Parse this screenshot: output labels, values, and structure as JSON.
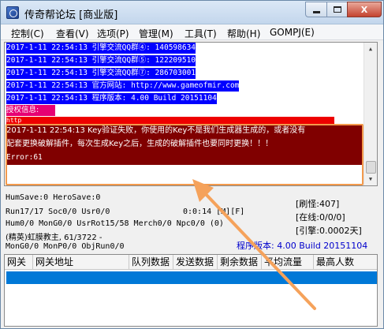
{
  "window": {
    "title": "传奇帮论坛 [商业版]",
    "close_label": "X"
  },
  "menu": {
    "items": [
      "控制(C)",
      "查看(V)",
      "选项(P)",
      "管理(M)",
      "工具(T)",
      "帮助(H)",
      "GOMPJ(E)"
    ]
  },
  "log": {
    "lines": [
      "2017-1-11 22:54:13 引擎交流QQ群④: 140598634",
      "2017-1-11 22:54:13 引擎交流QQ群⑤: 122209510",
      "2017-1-11 22:54:13 引擎交流QQ群⑦: 286703001",
      "2017-1-11 22:54:13 官方网站: http://www.gameofmir.com",
      "2017-1-11 22:54:13 程序版本: 4.00 Build 20151104"
    ],
    "auth_label": "授权信息:",
    "auth_url": "http",
    "error_line1": "2017-1-11 22:54:13 Key验证失败，你使用的Key不是我们生成器生成的，或者没有",
    "error_line2": "配套更换破解插件，每次生成Key之后，生成的破解插件也要同时更换！！！",
    "error_line3": "Error:61"
  },
  "status": {
    "hum_save": "HumSave:0 HeroSave:0",
    "run": "Run17/17 Soc0/0 Usr0/0",
    "time": "0:0:14 [M][F]",
    "hum": "Hum0/0 MonG0/0 UsrRot15/58 Merch0/0 Npc0/0 (0)",
    "elite": "(精英)虹膜教主, 61/3722 -",
    "mon": "MonG0/0 MonP0/0 ObjRun0/0",
    "refresh": "[刷怪:407]",
    "online": "[在线:0/0/0]",
    "engine": "[引擎:0.0002天]",
    "version": "程序版本: 4.00 Build 20151104"
  },
  "table": {
    "columns": [
      "网关",
      "网关地址",
      "队列数据",
      "发送数据",
      "剩余数据",
      "平均流量",
      "最高人数"
    ]
  },
  "colors": {
    "log_blue": "#0000ff",
    "auth_magenta": "#e60073",
    "error_red": "#800000",
    "highlight_orange": "#f39a4c",
    "arrow_orange": "#f5a25b"
  },
  "icons": {
    "app": "app-icon",
    "arrow": "orange-arrow-annotation"
  }
}
